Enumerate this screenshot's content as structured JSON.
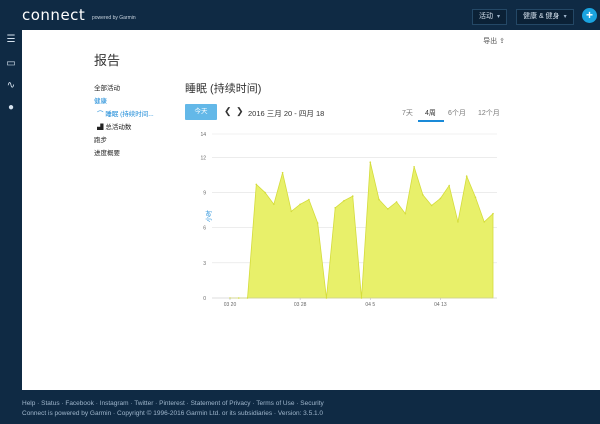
{
  "header": {
    "logo": "connect",
    "logo_sub": "powered by Garmin",
    "activity_btn": "活动",
    "health_btn": "健康 & 健身",
    "plus": "+"
  },
  "sidebar": {
    "icons": [
      "menu-icon",
      "inbox-icon",
      "link-icon",
      "user-icon"
    ]
  },
  "main": {
    "export": "导出",
    "page_title": "报告",
    "nav": {
      "all_activity": "全部活动",
      "health": "健康",
      "sleep": "睡眠 (持续时间...",
      "total_steps": "总活动数",
      "running": "跑步",
      "progress": "进度概要"
    },
    "chart_title": "睡眠 (持续时间)",
    "today_btn": "今天",
    "date_range": "2016 三月 20 - 四月 18",
    "range_tabs": [
      {
        "label": "7天",
        "active": false
      },
      {
        "label": "4周",
        "active": true
      },
      {
        "label": "6个月",
        "active": false
      },
      {
        "label": "12个月",
        "active": false
      }
    ]
  },
  "chart_data": {
    "type": "area",
    "ylabel": "小时",
    "ylim": [
      0,
      14
    ],
    "yticks": [
      "0",
      "3",
      "6",
      "9",
      "12",
      "14"
    ],
    "yticks_vals": [
      0,
      3,
      6,
      9,
      12,
      14
    ],
    "xticks": [
      "03 20",
      "03 28",
      "04 5",
      "04 13"
    ],
    "xtick_idx": [
      0,
      8,
      16,
      24
    ],
    "color": "#e8f06a",
    "stroke": "#d4dc3c",
    "values": [
      0,
      0,
      0,
      9.7,
      9,
      8,
      10.7,
      7.4,
      8,
      8.4,
      6.4,
      0,
      7.7,
      8.3,
      8.7,
      0,
      11.6,
      8.4,
      7.6,
      8.2,
      7.2,
      11.2,
      8.8,
      7.9,
      8.5,
      9.6,
      6.5,
      10.4,
      8.6,
      6.5,
      7.2
    ]
  }
}
